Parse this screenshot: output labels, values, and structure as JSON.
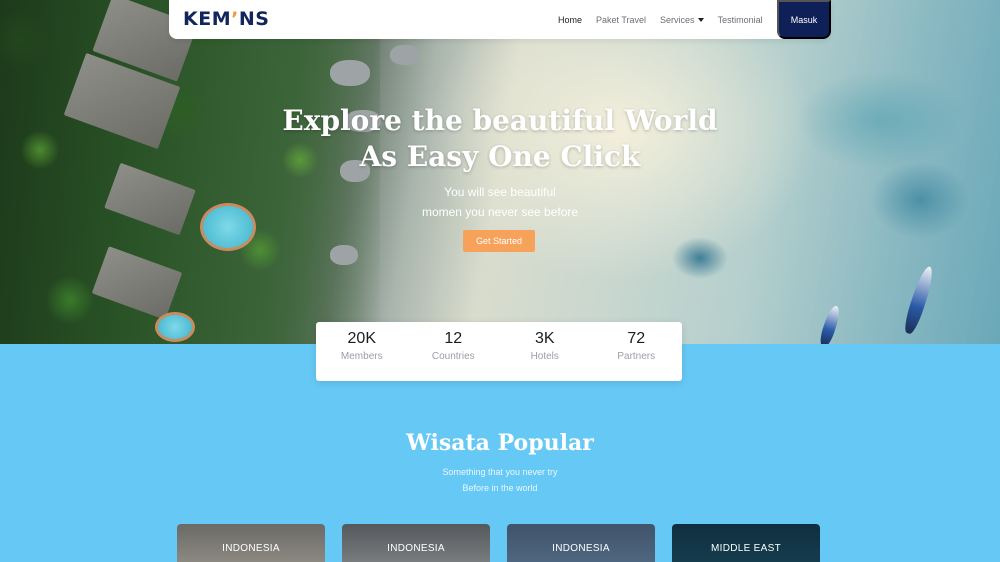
{
  "brand": {
    "logo_prefix": "KEM",
    "logo_mark": "’",
    "logo_suffix": "NS"
  },
  "nav": {
    "home": "Home",
    "paket_travel": "Paket Travel",
    "services": "Services",
    "testimonial": "Testimonial",
    "login": "Masuk"
  },
  "hero": {
    "title_line1": "Explore the beautiful World",
    "title_line2": "As Easy One Click",
    "subtitle_line1": "You will see beautiful",
    "subtitle_line2": "momen you never see before",
    "cta": "Get Started"
  },
  "stats": [
    {
      "value": "20K",
      "label": "Members"
    },
    {
      "value": "12",
      "label": "Countries"
    },
    {
      "value": "3K",
      "label": "Hotels"
    },
    {
      "value": "72",
      "label": "Partners"
    }
  ],
  "popular": {
    "title": "Wisata Popular",
    "subtitle_line1": "Something that you never try",
    "subtitle_line2": "Before in the world",
    "cards": [
      {
        "label": "INDONESIA"
      },
      {
        "label": "INDONESIA"
      },
      {
        "label": "INDONESIA"
      },
      {
        "label": "MIDDLE EAST"
      }
    ]
  },
  "colors": {
    "primary": "#0f1f57",
    "accent": "#f6a25b",
    "section_bg": "#66c9f5"
  }
}
